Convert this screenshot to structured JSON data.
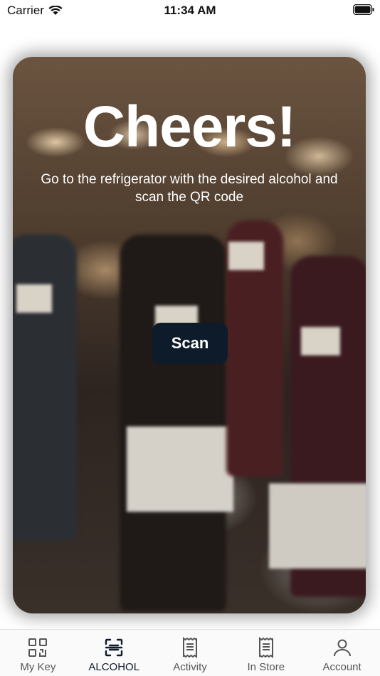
{
  "status_bar": {
    "carrier": "Carrier",
    "time": "11:34 AM"
  },
  "hero": {
    "title": "Cheers!",
    "subtitle": "Go to the refrigerator with the desired alcohol and scan the QR code",
    "scan_label": "Scan"
  },
  "tab_bar": {
    "items": [
      {
        "label": "My Key",
        "icon": "qr-grid-icon",
        "active": false
      },
      {
        "label": "ALCOHOL",
        "icon": "scan-frame-icon",
        "active": true
      },
      {
        "label": "Activity",
        "icon": "receipt-icon",
        "active": false
      },
      {
        "label": "In Store",
        "icon": "receipt-icon",
        "active": false
      },
      {
        "label": "Account",
        "icon": "person-icon",
        "active": false
      }
    ]
  },
  "colors": {
    "button_bg": "#0d1b2a",
    "active_tab": "#0d1b2a",
    "inactive_tab": "#555555"
  }
}
